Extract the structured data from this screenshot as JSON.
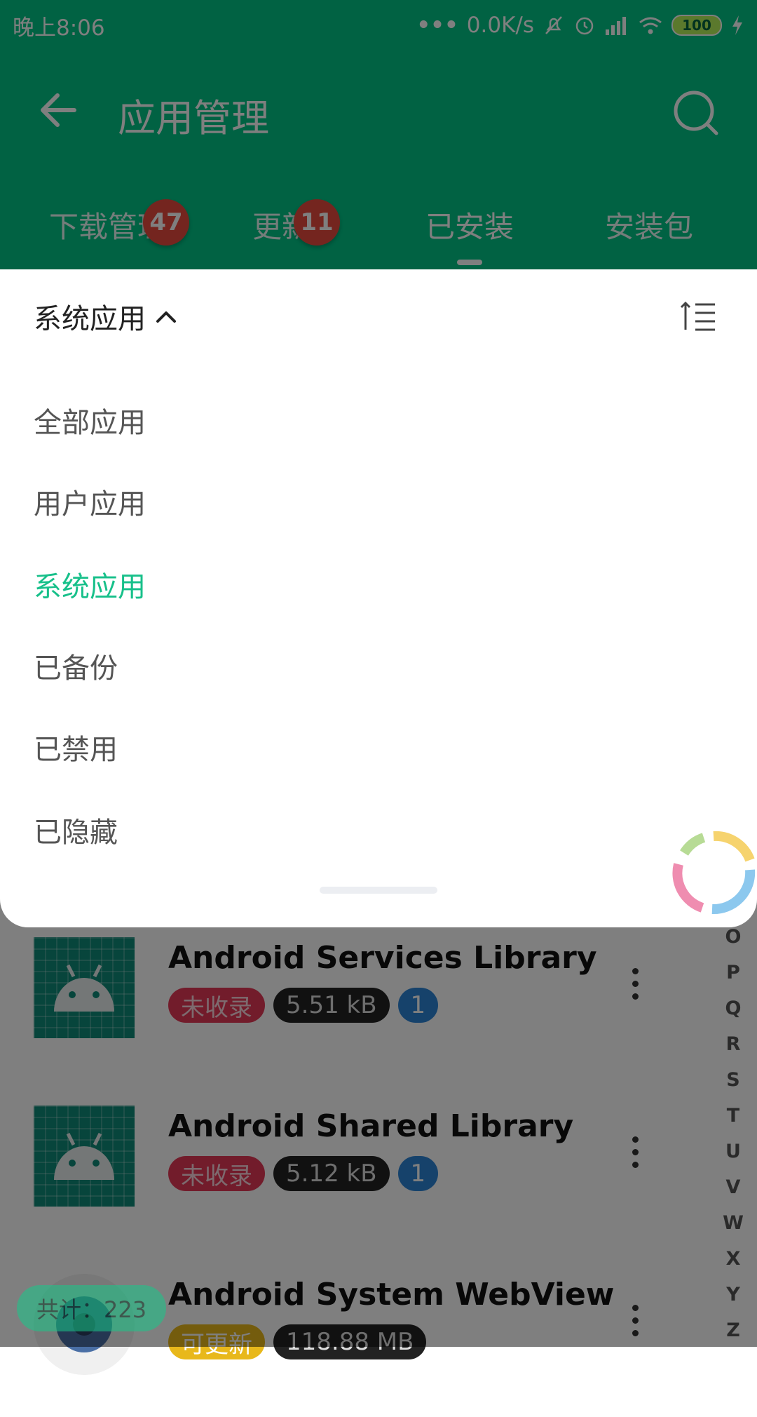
{
  "status_bar": {
    "time": "晚上8:06",
    "net_speed": "0.0K/s",
    "battery": "100"
  },
  "toolbar": {
    "title": "应用管理",
    "back_icon": "arrow-left-icon",
    "search_icon": "search-icon"
  },
  "tabs": [
    {
      "label": "下载管理",
      "badge": "47"
    },
    {
      "label": "更新",
      "badge": "11"
    },
    {
      "label": "已安装",
      "badge": ""
    },
    {
      "label": "安装包",
      "badge": ""
    }
  ],
  "active_tab": "已安装",
  "dropdown": {
    "header": "系统应用",
    "options": [
      "全部应用",
      "用户应用",
      "系统应用",
      "已备份",
      "已禁用",
      "已隐藏"
    ],
    "selected": "系统应用"
  },
  "apps": [
    {
      "name": "Android Services Library",
      "tag": "未收录",
      "size": "5.51 kB",
      "count": "1"
    },
    {
      "name": "Android Shared Library",
      "tag": "未收录",
      "size": "5.12 kB",
      "count": "1"
    },
    {
      "name": "Android System WebView",
      "tag": "可更新",
      "size": "118.88 MB",
      "count": ""
    }
  ],
  "alpha_index": [
    "O",
    "P",
    "Q",
    "R",
    "S",
    "T",
    "U",
    "V",
    "W",
    "X",
    "Y",
    "Z"
  ],
  "total": "共计：223",
  "colors": {
    "primary": "#02c587",
    "badge": "#e84a3f",
    "selected_text": "#17c08a"
  }
}
